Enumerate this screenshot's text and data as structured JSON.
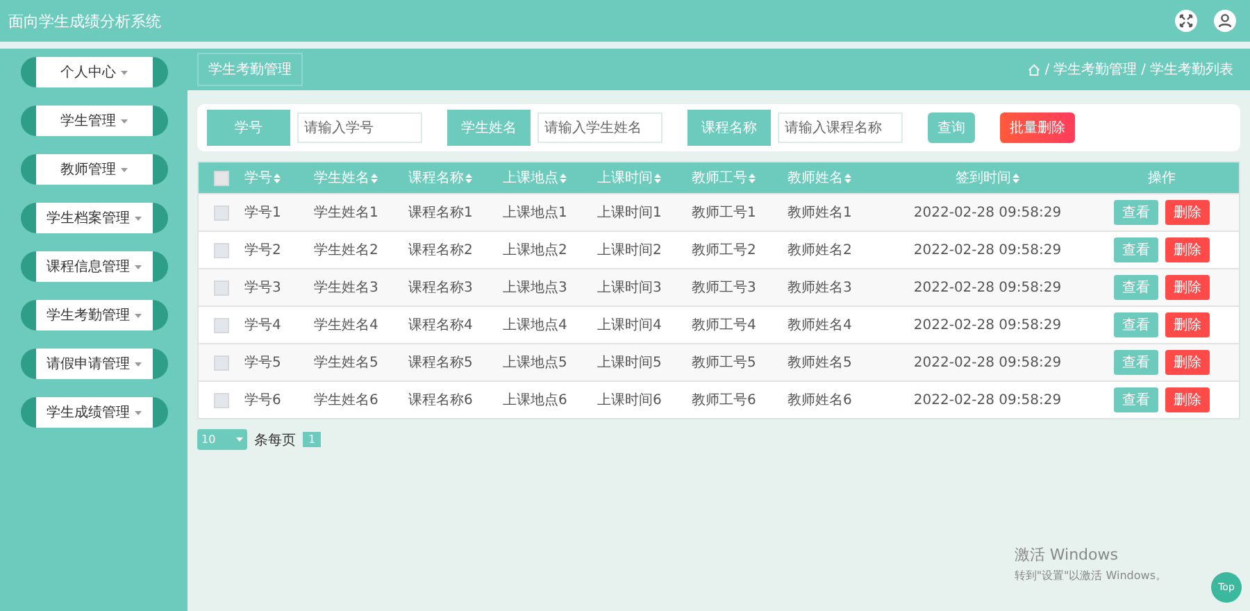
{
  "app": {
    "title": "面向学生成绩分析系统"
  },
  "sidebar": {
    "items": [
      {
        "label": "个人中心"
      },
      {
        "label": "学生管理"
      },
      {
        "label": "教师管理"
      },
      {
        "label": "学生档案管理"
      },
      {
        "label": "课程信息管理"
      },
      {
        "label": "学生考勤管理"
      },
      {
        "label": "请假申请管理"
      },
      {
        "label": "学生成绩管理"
      }
    ]
  },
  "page_tab": "学生考勤管理",
  "breadcrumb": [
    {
      "separator": "/",
      "label": "学生考勤管理"
    },
    {
      "separator": "/",
      "label": "学生考勤列表"
    }
  ],
  "search": {
    "fields": [
      {
        "label": "学号",
        "placeholder": "请输入学号"
      },
      {
        "label": "学生姓名",
        "placeholder": "请输入学生姓名"
      },
      {
        "label": "课程名称",
        "placeholder": "请输入课程名称"
      }
    ],
    "buttons": [
      {
        "label": "查询",
        "kind": "query"
      },
      {
        "label": "批量删除",
        "kind": "danger"
      }
    ]
  },
  "table": {
    "select_all_checked": false,
    "columns": [
      "学号",
      "学生姓名",
      "课程名称",
      "上课地点",
      "上课时间",
      "教师工号",
      "教师姓名",
      "签到时间",
      "操作"
    ],
    "rows": [
      {
        "checked": false,
        "cells": [
          "学号1",
          "学生姓名1",
          "课程名称1",
          "上课地点1",
          "上课时间1",
          "教师工号1",
          "教师姓名1",
          "2022-02-28 09:58:29"
        ],
        "actions": [
          {
            "label": "查看",
            "kind": "view"
          },
          {
            "label": "删除",
            "kind": "delete"
          }
        ]
      },
      {
        "checked": false,
        "cells": [
          "学号2",
          "学生姓名2",
          "课程名称2",
          "上课地点2",
          "上课时间2",
          "教师工号2",
          "教师姓名2",
          "2022-02-28 09:58:29"
        ],
        "actions": [
          {
            "label": "查看",
            "kind": "view"
          },
          {
            "label": "删除",
            "kind": "delete"
          }
        ]
      },
      {
        "checked": false,
        "cells": [
          "学号3",
          "学生姓名3",
          "课程名称3",
          "上课地点3",
          "上课时间3",
          "教师工号3",
          "教师姓名3",
          "2022-02-28 09:58:29"
        ],
        "actions": [
          {
            "label": "查看",
            "kind": "view"
          },
          {
            "label": "删除",
            "kind": "delete"
          }
        ]
      },
      {
        "checked": false,
        "cells": [
          "学号4",
          "学生姓名4",
          "课程名称4",
          "上课地点4",
          "上课时间4",
          "教师工号4",
          "教师姓名4",
          "2022-02-28 09:58:29"
        ],
        "actions": [
          {
            "label": "查看",
            "kind": "view"
          },
          {
            "label": "删除",
            "kind": "delete"
          }
        ]
      },
      {
        "checked": false,
        "cells": [
          "学号5",
          "学生姓名5",
          "课程名称5",
          "上课地点5",
          "上课时间5",
          "教师工号5",
          "教师姓名5",
          "2022-02-28 09:58:29"
        ],
        "actions": [
          {
            "label": "查看",
            "kind": "view"
          },
          {
            "label": "删除",
            "kind": "delete"
          }
        ]
      },
      {
        "checked": false,
        "cells": [
          "学号6",
          "学生姓名6",
          "课程名称6",
          "上课地点6",
          "上课时间6",
          "教师工号6",
          "教师姓名6",
          "2022-02-28 09:58:29"
        ],
        "actions": [
          {
            "label": "查看",
            "kind": "view"
          },
          {
            "label": "删除",
            "kind": "delete"
          }
        ]
      }
    ]
  },
  "pagination": {
    "page_size": "10",
    "page_size_label": "条每页",
    "pages": [
      {
        "label": "1",
        "selected": true
      }
    ]
  },
  "os_notice": {
    "title": "激活 Windows",
    "text": "转到\"设置\"以激活 Windows。"
  },
  "top_button": "Top"
}
